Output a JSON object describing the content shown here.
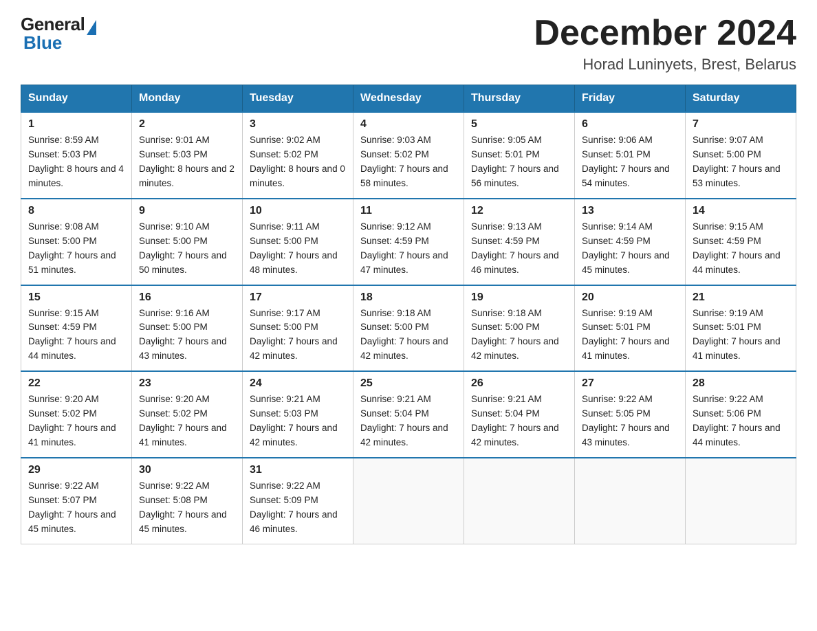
{
  "header": {
    "logo": {
      "general": "General",
      "blue": "Blue",
      "underline": "GeneralBlue"
    },
    "title": "December 2024",
    "subtitle": "Horad Luninyets, Brest, Belarus"
  },
  "weekdays": [
    "Sunday",
    "Monday",
    "Tuesday",
    "Wednesday",
    "Thursday",
    "Friday",
    "Saturday"
  ],
  "weeks": [
    [
      {
        "day": "1",
        "sunrise": "8:59 AM",
        "sunset": "5:03 PM",
        "daylight": "8 hours and 4 minutes."
      },
      {
        "day": "2",
        "sunrise": "9:01 AM",
        "sunset": "5:03 PM",
        "daylight": "8 hours and 2 minutes."
      },
      {
        "day": "3",
        "sunrise": "9:02 AM",
        "sunset": "5:02 PM",
        "daylight": "8 hours and 0 minutes."
      },
      {
        "day": "4",
        "sunrise": "9:03 AM",
        "sunset": "5:02 PM",
        "daylight": "7 hours and 58 minutes."
      },
      {
        "day": "5",
        "sunrise": "9:05 AM",
        "sunset": "5:01 PM",
        "daylight": "7 hours and 56 minutes."
      },
      {
        "day": "6",
        "sunrise": "9:06 AM",
        "sunset": "5:01 PM",
        "daylight": "7 hours and 54 minutes."
      },
      {
        "day": "7",
        "sunrise": "9:07 AM",
        "sunset": "5:00 PM",
        "daylight": "7 hours and 53 minutes."
      }
    ],
    [
      {
        "day": "8",
        "sunrise": "9:08 AM",
        "sunset": "5:00 PM",
        "daylight": "7 hours and 51 minutes."
      },
      {
        "day": "9",
        "sunrise": "9:10 AM",
        "sunset": "5:00 PM",
        "daylight": "7 hours and 50 minutes."
      },
      {
        "day": "10",
        "sunrise": "9:11 AM",
        "sunset": "5:00 PM",
        "daylight": "7 hours and 48 minutes."
      },
      {
        "day": "11",
        "sunrise": "9:12 AM",
        "sunset": "4:59 PM",
        "daylight": "7 hours and 47 minutes."
      },
      {
        "day": "12",
        "sunrise": "9:13 AM",
        "sunset": "4:59 PM",
        "daylight": "7 hours and 46 minutes."
      },
      {
        "day": "13",
        "sunrise": "9:14 AM",
        "sunset": "4:59 PM",
        "daylight": "7 hours and 45 minutes."
      },
      {
        "day": "14",
        "sunrise": "9:15 AM",
        "sunset": "4:59 PM",
        "daylight": "7 hours and 44 minutes."
      }
    ],
    [
      {
        "day": "15",
        "sunrise": "9:15 AM",
        "sunset": "4:59 PM",
        "daylight": "7 hours and 44 minutes."
      },
      {
        "day": "16",
        "sunrise": "9:16 AM",
        "sunset": "5:00 PM",
        "daylight": "7 hours and 43 minutes."
      },
      {
        "day": "17",
        "sunrise": "9:17 AM",
        "sunset": "5:00 PM",
        "daylight": "7 hours and 42 minutes."
      },
      {
        "day": "18",
        "sunrise": "9:18 AM",
        "sunset": "5:00 PM",
        "daylight": "7 hours and 42 minutes."
      },
      {
        "day": "19",
        "sunrise": "9:18 AM",
        "sunset": "5:00 PM",
        "daylight": "7 hours and 42 minutes."
      },
      {
        "day": "20",
        "sunrise": "9:19 AM",
        "sunset": "5:01 PM",
        "daylight": "7 hours and 41 minutes."
      },
      {
        "day": "21",
        "sunrise": "9:19 AM",
        "sunset": "5:01 PM",
        "daylight": "7 hours and 41 minutes."
      }
    ],
    [
      {
        "day": "22",
        "sunrise": "9:20 AM",
        "sunset": "5:02 PM",
        "daylight": "7 hours and 41 minutes."
      },
      {
        "day": "23",
        "sunrise": "9:20 AM",
        "sunset": "5:02 PM",
        "daylight": "7 hours and 41 minutes."
      },
      {
        "day": "24",
        "sunrise": "9:21 AM",
        "sunset": "5:03 PM",
        "daylight": "7 hours and 42 minutes."
      },
      {
        "day": "25",
        "sunrise": "9:21 AM",
        "sunset": "5:04 PM",
        "daylight": "7 hours and 42 minutes."
      },
      {
        "day": "26",
        "sunrise": "9:21 AM",
        "sunset": "5:04 PM",
        "daylight": "7 hours and 42 minutes."
      },
      {
        "day": "27",
        "sunrise": "9:22 AM",
        "sunset": "5:05 PM",
        "daylight": "7 hours and 43 minutes."
      },
      {
        "day": "28",
        "sunrise": "9:22 AM",
        "sunset": "5:06 PM",
        "daylight": "7 hours and 44 minutes."
      }
    ],
    [
      {
        "day": "29",
        "sunrise": "9:22 AM",
        "sunset": "5:07 PM",
        "daylight": "7 hours and 45 minutes."
      },
      {
        "day": "30",
        "sunrise": "9:22 AM",
        "sunset": "5:08 PM",
        "daylight": "7 hours and 45 minutes."
      },
      {
        "day": "31",
        "sunrise": "9:22 AM",
        "sunset": "5:09 PM",
        "daylight": "7 hours and 46 minutes."
      },
      null,
      null,
      null,
      null
    ]
  ]
}
